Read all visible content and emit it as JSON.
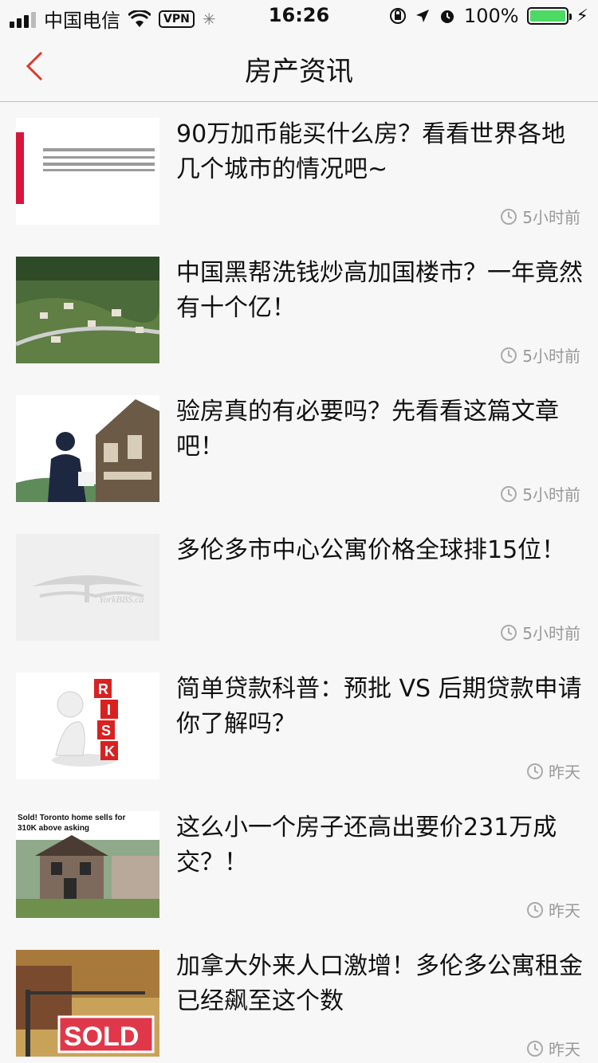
{
  "status": {
    "carrier": "中国电信",
    "vpn": "VPN",
    "time": "16:26",
    "battery": "100%"
  },
  "nav": {
    "title": "房产资讯"
  },
  "articles": [
    {
      "title": "90万加币能买什么房？看看世界各地几个城市的情况吧~",
      "time": "5小时前"
    },
    {
      "title": "中国黑帮洗钱炒高加国楼市？一年竟然有十个亿！",
      "time": "5小时前"
    },
    {
      "title": "验房真的有必要吗？先看看这篇文章吧！",
      "time": "5小时前"
    },
    {
      "title": "多伦多市中心公寓价格全球排15位！",
      "time": "5小时前"
    },
    {
      "title": "简单贷款科普：预批 VS 后期贷款申请你了解吗？",
      "time": "昨天"
    },
    {
      "title": "这么小一个房子还高出要价231万成交？！",
      "time": "昨天"
    },
    {
      "title": "加拿大外来人口激增！多伦多公寓租金已经飙至这个数",
      "time": "昨天"
    }
  ],
  "thumbs": {
    "t4_watermark": "YorkBBS.ca",
    "t5_letters": [
      "R",
      "I",
      "S",
      "K"
    ],
    "t6_caption_1": "Sold! Toronto home sells for",
    "t6_caption_2": "310K above asking",
    "t7_sign": "SOLD"
  },
  "colors": {
    "accent": "#e0382b",
    "meta": "#999999"
  }
}
